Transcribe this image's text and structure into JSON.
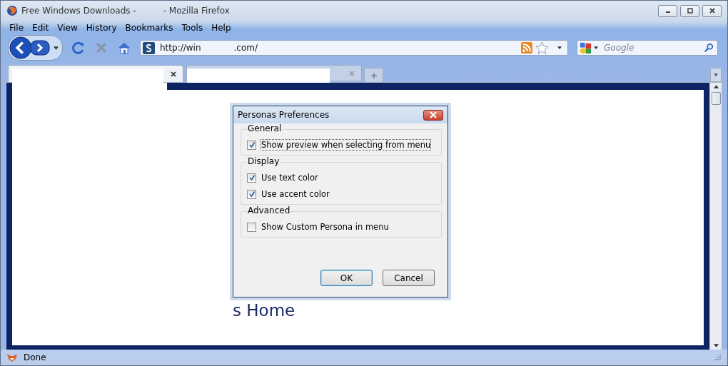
{
  "window": {
    "title_start": "Free Windows Downloads -",
    "title_end": "- Mozilla Firefox"
  },
  "menu": [
    "File",
    "Edit",
    "View",
    "History",
    "Bookmarks",
    "Tools",
    "Help"
  ],
  "address": {
    "start": "http://win",
    "end": ".com/"
  },
  "search": {
    "placeholder": "Google"
  },
  "tabs": [
    {
      "selected": true
    },
    {
      "selected": false
    }
  ],
  "page": {
    "heading_fragment": "s Home"
  },
  "dialog": {
    "title": "Personas Preferences",
    "groups": [
      {
        "label": "General",
        "options": [
          {
            "label": "Show preview when selecting from menu",
            "checked": true,
            "focused": true
          }
        ]
      },
      {
        "label": "Display",
        "options": [
          {
            "label": "Use text color",
            "checked": true,
            "focused": false
          },
          {
            "label": "Use accent color",
            "checked": true,
            "focused": false
          }
        ]
      },
      {
        "label": "Advanced",
        "options": [
          {
            "label": "Show Custom Persona in menu",
            "checked": false,
            "focused": false
          }
        ]
      }
    ],
    "buttons": [
      {
        "label": "OK",
        "default": true
      },
      {
        "label": "Cancel",
        "default": false
      }
    ]
  },
  "status_bar": {
    "text": "Done"
  }
}
